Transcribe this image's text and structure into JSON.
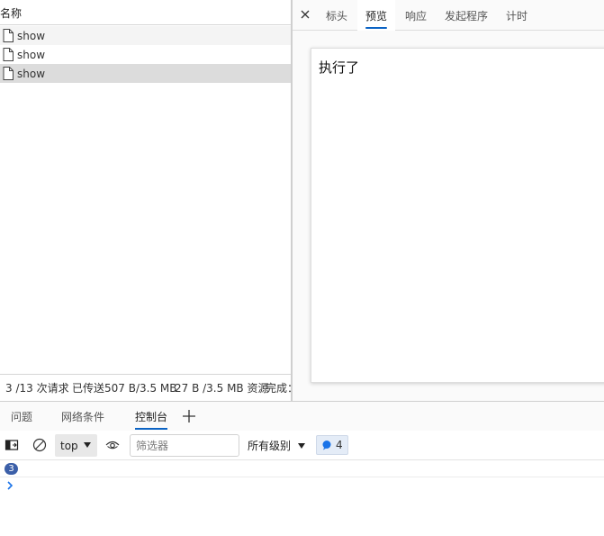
{
  "request_list": {
    "header": "名称",
    "rows": [
      {
        "name": "show"
      },
      {
        "name": "show"
      },
      {
        "name": "show"
      }
    ],
    "status": {
      "requests": "3 /13 次请求",
      "transferred": "已传送507 B/3.5 MB",
      "resources": "27 B /3.5 MB 资源",
      "finish": "完成："
    }
  },
  "detail": {
    "tabs": [
      "标头",
      "预览",
      "响应",
      "发起程序",
      "计时"
    ],
    "active_tab": "预览",
    "preview_text": "执行了"
  },
  "drawer": {
    "tabs": [
      "问题",
      "网络条件",
      "控制台"
    ],
    "active_tab": "控制台"
  },
  "console": {
    "context": "top",
    "filter_placeholder": "筛选器",
    "level": "所有级别",
    "issues_count": "4",
    "repeat_count": "3"
  },
  "colors": {
    "accent": "#0b63c4",
    "selected_row": "#dcdcdc",
    "badge": "#3b5fa8"
  }
}
